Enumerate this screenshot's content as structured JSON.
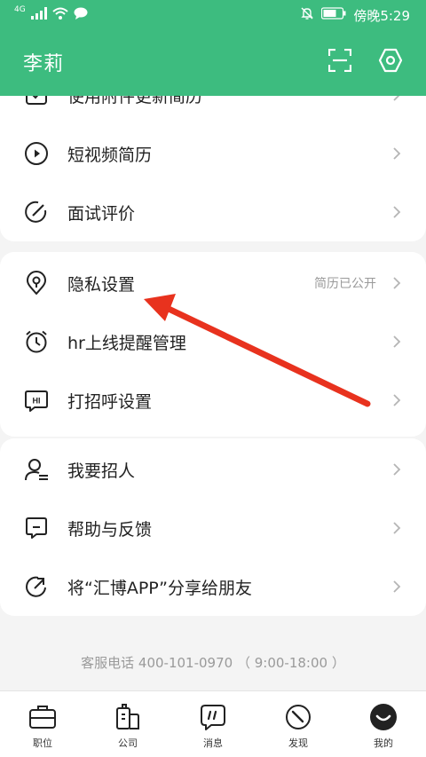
{
  "status_bar": {
    "network": "4G",
    "time": "傍晚5:29"
  },
  "header": {
    "user_name": "李莉"
  },
  "list_top": [
    {
      "label": "使用附件更新简历",
      "icon": "attachment-resume-icon"
    },
    {
      "label": "短视频简历",
      "icon": "play-circle-icon"
    },
    {
      "label": "面试评价",
      "icon": "interview-review-icon"
    }
  ],
  "list_middle": [
    {
      "label": "隐私设置",
      "hint": "简历已公开",
      "icon": "location-pin-icon"
    },
    {
      "label": "hr上线提醒管理",
      "icon": "alarm-clock-icon"
    },
    {
      "label": "打招呼设置",
      "icon": "hi-bubble-icon"
    }
  ],
  "list_bottom": [
    {
      "label": "我要招人",
      "icon": "recruit-user-icon"
    },
    {
      "label": "帮助与反馈",
      "icon": "feedback-icon"
    },
    {
      "label": "将“汇博APP”分享给朋友",
      "icon": "share-icon"
    }
  ],
  "service_line": "客服电话 400-101-0970 （ 9:00-18:00 ）",
  "tabs": [
    {
      "label": "职位",
      "icon": "briefcase-icon"
    },
    {
      "label": "公司",
      "icon": "building-icon"
    },
    {
      "label": "消息",
      "icon": "message-icon"
    },
    {
      "label": "发现",
      "icon": "compass-icon"
    },
    {
      "label": "我的",
      "icon": "profile-icon"
    }
  ],
  "colors": {
    "brand_green": "#3dbc7f",
    "annotation_red": "#e8321e"
  }
}
